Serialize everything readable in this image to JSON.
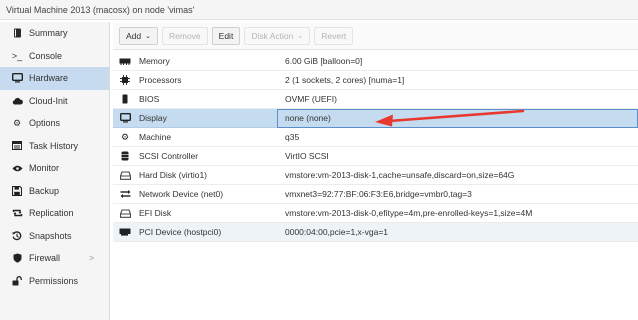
{
  "window": {
    "title": "Virtual Machine 2013 (macosx) on node 'vimas'"
  },
  "sidebar": {
    "items": [
      {
        "label": "Summary",
        "icon": "book-icon"
      },
      {
        "label": "Console",
        "icon": "terminal-icon"
      },
      {
        "label": "Hardware",
        "icon": "monitor-icon"
      },
      {
        "label": "Cloud-Init",
        "icon": "cloud-icon"
      },
      {
        "label": "Options",
        "icon": "gear-icon"
      },
      {
        "label": "Task History",
        "icon": "list-icon"
      },
      {
        "label": "Monitor",
        "icon": "eye-icon"
      },
      {
        "label": "Backup",
        "icon": "floppy-icon"
      },
      {
        "label": "Replication",
        "icon": "retweet-icon"
      },
      {
        "label": "Snapshots",
        "icon": "history-icon"
      },
      {
        "label": "Firewall",
        "icon": "shield-icon"
      },
      {
        "label": "Permissions",
        "icon": "unlock-icon"
      }
    ],
    "active": "Hardware",
    "firewall_chevron": ">"
  },
  "toolbar": {
    "add_label": "Add",
    "remove_label": "Remove",
    "edit_label": "Edit",
    "disk_action_label": "Disk Action",
    "revert_label": "Revert"
  },
  "hardware": {
    "rows": [
      {
        "name": "Memory",
        "value": "6.00 GiB [balloon=0]",
        "icon": "memory-icon"
      },
      {
        "name": "Processors",
        "value": "2 (1 sockets, 2 cores) [numa=1]",
        "icon": "cpu-icon"
      },
      {
        "name": "BIOS",
        "value": "OVMF (UEFI)",
        "icon": "microchip-icon"
      },
      {
        "name": "Display",
        "value": "none (none)",
        "icon": "desktop-icon"
      },
      {
        "name": "Machine",
        "value": "q35",
        "icon": "cogs-icon"
      },
      {
        "name": "SCSI Controller",
        "value": "VirtIO SCSI",
        "icon": "database-icon"
      },
      {
        "name": "Hard Disk (virtio1)",
        "value": "vmstore:vm-2013-disk-1,cache=unsafe,discard=on,size=64G",
        "icon": "hdd-icon"
      },
      {
        "name": "Network Device (net0)",
        "value": "vmxnet3=92:77:BF:06:F3:E6,bridge=vmbr0,tag=3",
        "icon": "exchange-icon"
      },
      {
        "name": "EFI Disk",
        "value": "vmstore:vm-2013-disk-0,efitype=4m,pre-enrolled-keys=1,size=4M",
        "icon": "hdd-icon"
      },
      {
        "name": "PCI Device (hostpci0)",
        "value": "0000:04:00,pcie=1,x-vga=1",
        "icon": "pci-card-icon"
      }
    ],
    "selected": "Display",
    "alt_highlight": "PCI Device (hostpci0)"
  },
  "annotation": {
    "arrow_color": "#e8392e"
  }
}
